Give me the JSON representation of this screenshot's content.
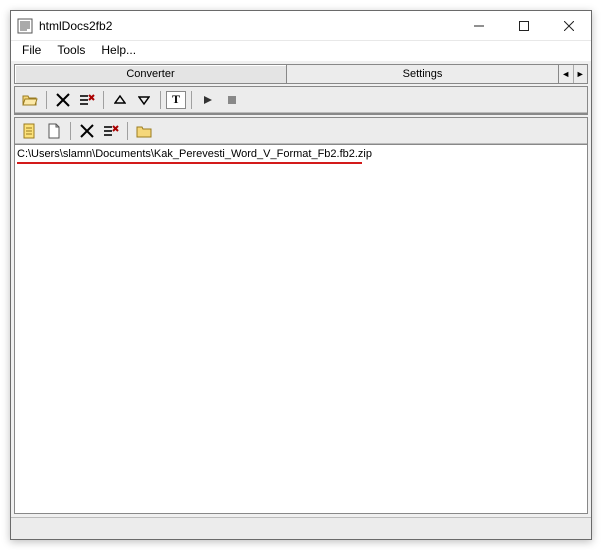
{
  "window": {
    "title": "htmlDocs2fb2"
  },
  "menu": {
    "file": "File",
    "tools": "Tools",
    "help": "Help..."
  },
  "tabs": {
    "converter": "Converter",
    "settings": "Settings"
  },
  "upper_toolbar": {
    "open": "open-icon",
    "delete": "delete-icon",
    "clear": "clear-list-icon",
    "up": "up-icon",
    "down": "down-icon",
    "text": "T",
    "play": "play-icon",
    "stop": "stop-icon"
  },
  "lower_toolbar": {
    "explore": "explore-icon",
    "new": "new-doc-icon",
    "delete": "delete-icon",
    "clear": "clear-list-icon",
    "folder": "folder-icon"
  },
  "file_list": {
    "item0": "C:\\Users\\slamn\\Documents\\Kak_Perevesti_Word_V_Format_Fb2.fb2.zip"
  }
}
